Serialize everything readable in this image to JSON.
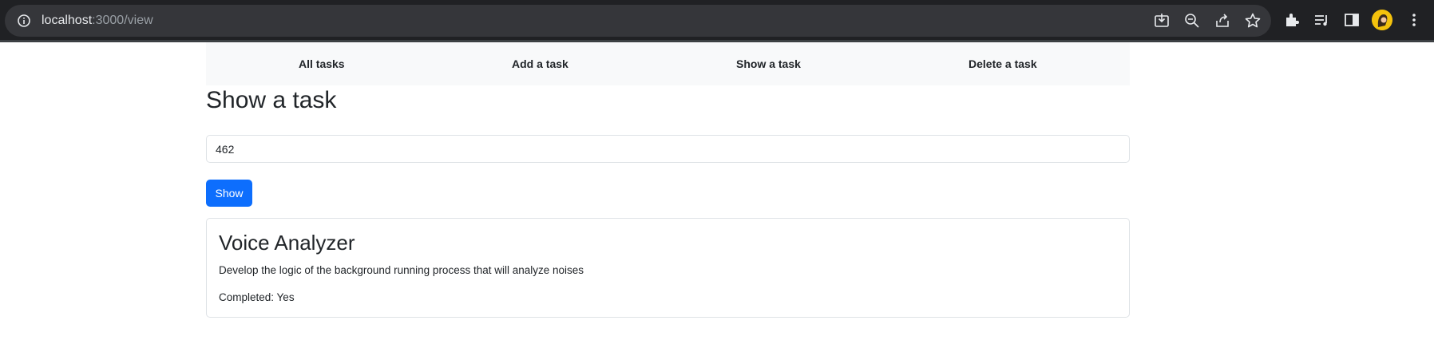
{
  "browser": {
    "url_host": "localhost",
    "url_path": ":3000/view",
    "icons": [
      "info-icon",
      "install-icon",
      "zoom-out-icon",
      "share-icon",
      "bookmark-star-icon",
      "extensions-icon",
      "reading-list-icon",
      "side-panel-icon",
      "profile-avatar",
      "menu-dots-icon"
    ]
  },
  "nav": {
    "items": [
      {
        "label": "All tasks"
      },
      {
        "label": "Add a task"
      },
      {
        "label": "Show a task"
      },
      {
        "label": "Delete a task"
      }
    ]
  },
  "page": {
    "title": "Show a task"
  },
  "form": {
    "task_id_value": "462",
    "show_label": "Show"
  },
  "task": {
    "title": "Voice Analyzer",
    "description": "Develop the logic of the background running process that will analyze noises",
    "completed_text": "Completed: Yes"
  },
  "colors": {
    "primary": "#0d6efd",
    "navbar_bg": "#f8f9fa",
    "chrome_bg": "#202124",
    "omnibox_bg": "#35363a"
  }
}
